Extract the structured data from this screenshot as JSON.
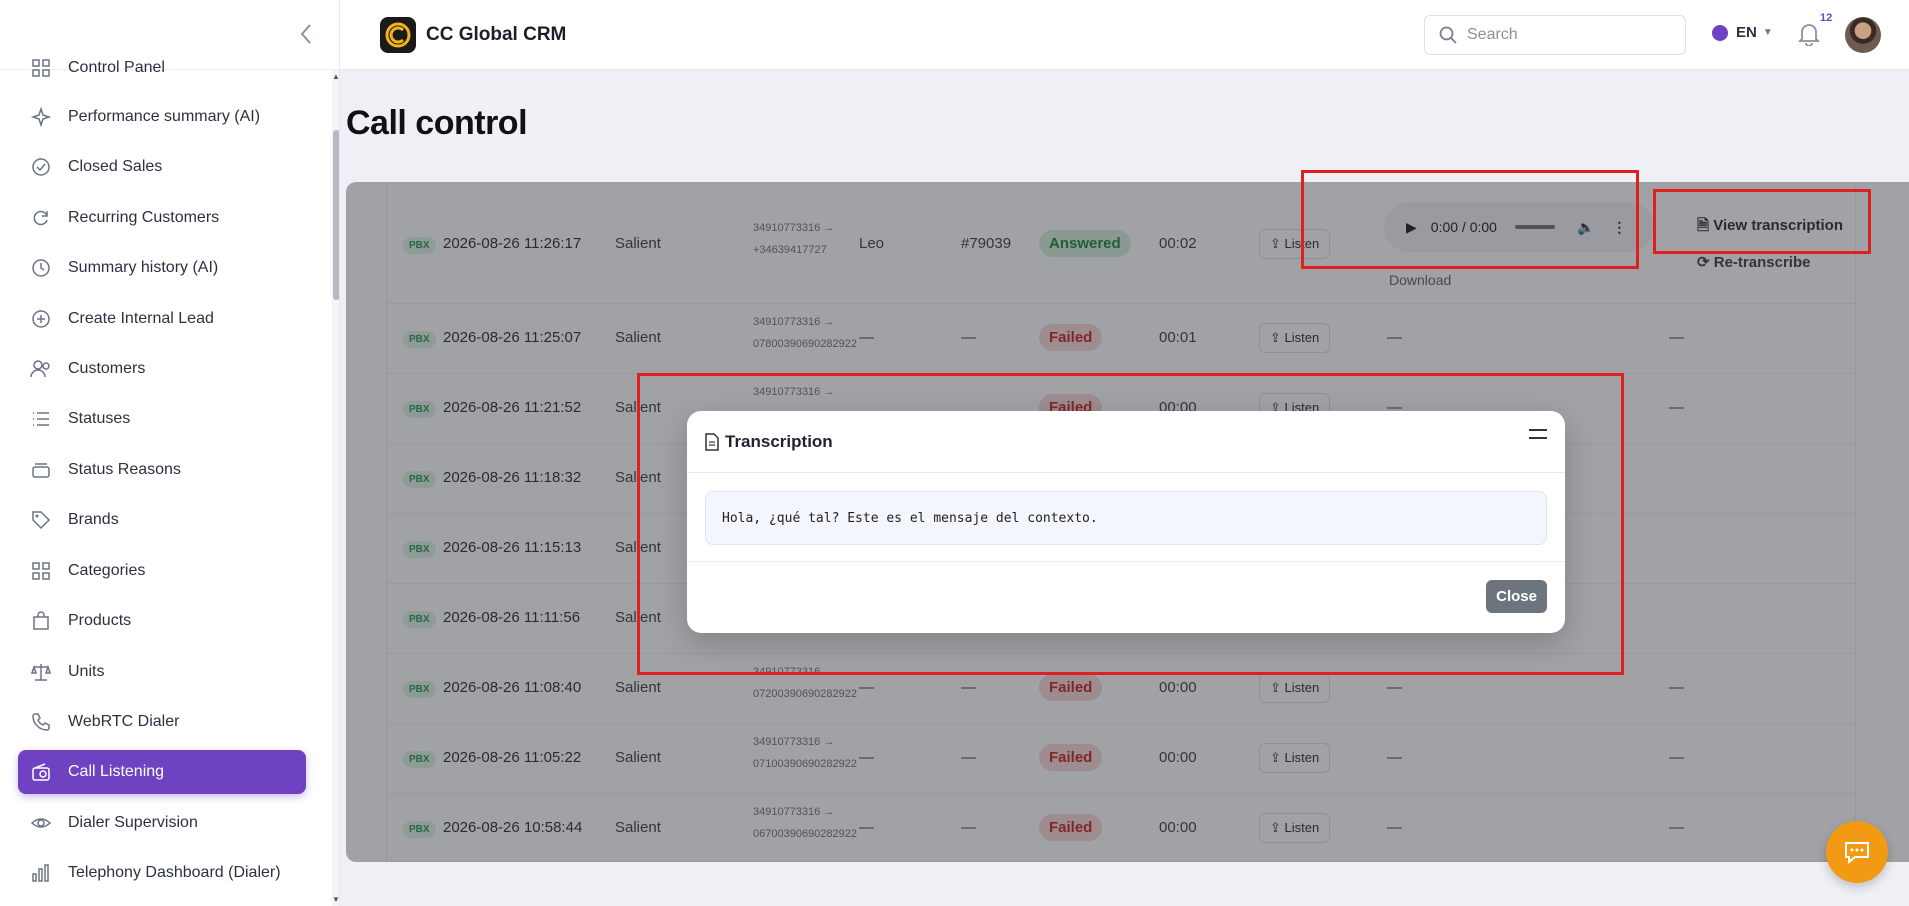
{
  "topbar": {
    "app_name": "CC Global CRM",
    "search_placeholder": "Search",
    "language": "EN",
    "notification_count": "12"
  },
  "sidebar": {
    "items": [
      {
        "label": "Control Panel",
        "icon": "grid-icon"
      },
      {
        "label": "Performance summary (AI)",
        "icon": "sparkle-icon"
      },
      {
        "label": "Closed Sales",
        "icon": "check-circle-icon"
      },
      {
        "label": "Recurring Customers",
        "icon": "refresh-icon"
      },
      {
        "label": "Summary history (AI)",
        "icon": "clock-icon"
      },
      {
        "label": "Create Internal Lead",
        "icon": "plus-circle-icon"
      },
      {
        "label": "Customers",
        "icon": "users-icon"
      },
      {
        "label": "Statuses",
        "icon": "list-icon"
      },
      {
        "label": "Status Reasons",
        "icon": "layers-icon"
      },
      {
        "label": "Brands",
        "icon": "tag-icon"
      },
      {
        "label": "Categories",
        "icon": "grid-icon"
      },
      {
        "label": "Products",
        "icon": "bag-icon"
      },
      {
        "label": "Units",
        "icon": "scale-icon"
      },
      {
        "label": "WebRTC Dialer",
        "icon": "phone-icon"
      },
      {
        "label": "Call Listening",
        "icon": "radio-icon",
        "active": true
      },
      {
        "label": "Dialer Supervision",
        "icon": "eye-icon"
      },
      {
        "label": "Telephony Dashboard (Dialer)",
        "icon": "bar-chart-icon"
      }
    ]
  },
  "main": {
    "page_title": "Call control",
    "rows": [
      {
        "badge": "PBX",
        "date": "2026-08-26 11:26:17",
        "source": "Salient",
        "from": "34910773316 →",
        "to": "+34639417727",
        "agent": "Leo",
        "ticket": "#79039",
        "status": "Answered",
        "duration": "00:02",
        "listen": "Listen"
      },
      {
        "badge": "PBX",
        "date": "2026-08-26 11:25:07",
        "source": "Salient",
        "from": "34910773316 →",
        "to": "07800390690282922",
        "agent": "—",
        "ticket": "—",
        "status": "Failed",
        "duration": "00:01",
        "listen": "Listen"
      },
      {
        "badge": "PBX",
        "date": "2026-08-26 11:21:52",
        "source": "Salient",
        "from": "34910773316 →",
        "to": "",
        "agent": "",
        "ticket": "",
        "status": "Failed",
        "duration": "00:00",
        "listen": "Listen"
      },
      {
        "badge": "PBX",
        "date": "2026-08-26 11:18:32",
        "source": "Salient",
        "from": "",
        "to": "",
        "agent": "",
        "ticket": "",
        "status": "",
        "duration": "",
        "listen": ""
      },
      {
        "badge": "PBX",
        "date": "2026-08-26 11:15:13",
        "source": "Salient",
        "from": "",
        "to": "",
        "agent": "",
        "ticket": "",
        "status": "",
        "duration": "",
        "listen": ""
      },
      {
        "badge": "PBX",
        "date": "2026-08-26 11:11:56",
        "source": "Salient",
        "from": "",
        "to": "",
        "agent": "",
        "ticket": "",
        "status": "",
        "duration": "",
        "listen": ""
      },
      {
        "badge": "PBX",
        "date": "2026-08-26 11:08:40",
        "source": "Salient",
        "from": "34910773316 →",
        "to": "07200390690282922",
        "agent": "—",
        "ticket": "—",
        "status": "Failed",
        "duration": "00:00",
        "listen": "Listen"
      },
      {
        "badge": "PBX",
        "date": "2026-08-26 11:05:22",
        "source": "Salient",
        "from": "34910773316 →",
        "to": "07100390690282922",
        "agent": "—",
        "ticket": "—",
        "status": "Failed",
        "duration": "00:00",
        "listen": "Listen"
      },
      {
        "badge": "PBX",
        "date": "2026-08-26 10:58:44",
        "source": "Salient",
        "from": "34910773316 →",
        "to": "06700390690282922",
        "agent": "—",
        "ticket": "—",
        "status": "Failed",
        "duration": "00:00",
        "listen": "Listen"
      }
    ],
    "audio": {
      "time": "0:00 / 0:00",
      "download": "Download"
    },
    "actions": {
      "view_transcription": "View transcription",
      "retranscribe": "Re-transcribe",
      "dash": "—"
    }
  },
  "modal": {
    "title": "Transcription",
    "text": "Hola, ¿qué tal? Este es el mensaje del contexto.",
    "close_label": "Close"
  },
  "colors": {
    "accent": "#6f42c1",
    "highlight": "#e02020",
    "fab": "#f29a14"
  }
}
